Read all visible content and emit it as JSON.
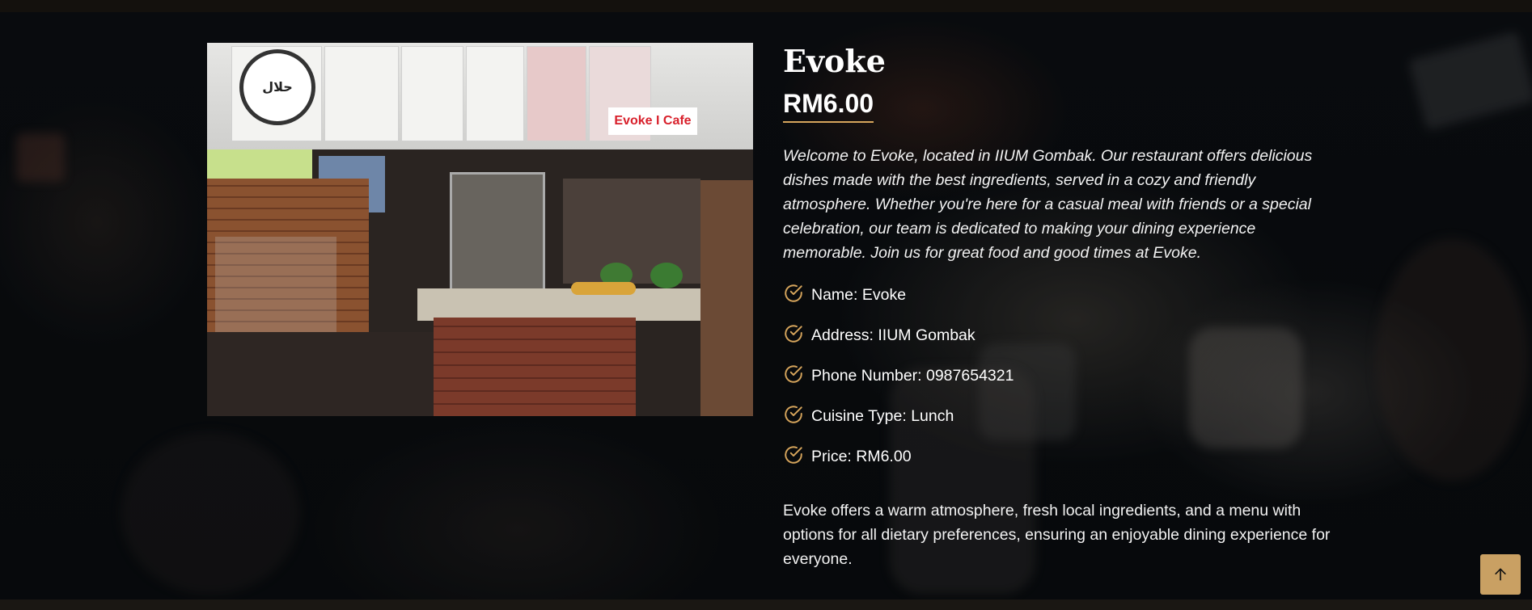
{
  "restaurant": {
    "name": "Evoke",
    "price_heading": "RM6.00",
    "description": "Welcome to Evoke, located in IIUM Gombak. Our restaurant offers delicious dishes made with the best ingredients, served in a cozy and friendly atmosphere. Whether you're here for a casual meal with friends or a special celebration, our team is dedicated to making your dining experience memorable. Join us for great food and good times at Evoke.",
    "details": [
      {
        "label": "Name: Evoke",
        "icon": "check-circle-icon"
      },
      {
        "label": "Address: IIUM Gombak",
        "icon": "check-circle-icon"
      },
      {
        "label": "Phone Number: 0987654321",
        "icon": "check-circle-icon"
      },
      {
        "label": "Cuisine Type: Lunch",
        "icon": "check-circle-icon"
      },
      {
        "label": "Price: RM6.00",
        "icon": "check-circle-icon"
      }
    ],
    "closing": "Evoke offers a warm atmosphere, fresh local ingredients, and a menu with options for all dietary preferences, ensuring an enjoyable dining experience for everyone."
  },
  "photo": {
    "halal_text": "حلال",
    "sign_text": "Evoke I Cafe"
  },
  "back_to_top": {
    "icon": "arrow-up-icon"
  },
  "colors": {
    "accent": "#c9a063",
    "underline": "#d6a55c",
    "background": "#0b0e12",
    "text": "#ffffff"
  }
}
